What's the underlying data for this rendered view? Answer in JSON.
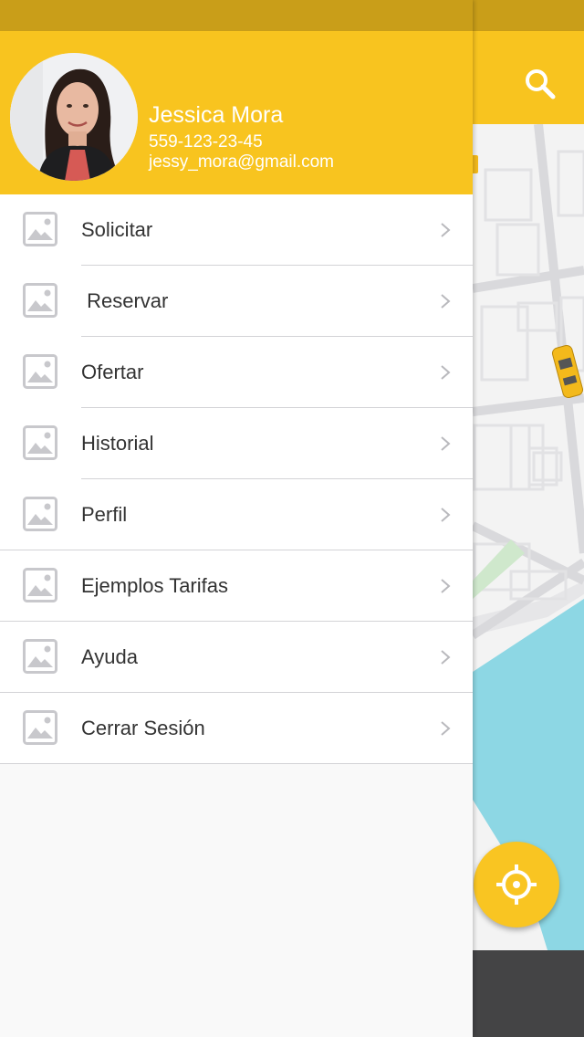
{
  "profile": {
    "name": "Jessica Mora",
    "phone": "559-123-23-45",
    "email": "jessy_mora@gmail.com"
  },
  "menu": {
    "items": [
      {
        "label": "Solicitar",
        "icon": "image-placeholder-icon"
      },
      {
        "label": " Reservar",
        "icon": "image-placeholder-icon"
      },
      {
        "label": "Ofertar",
        "icon": "image-placeholder-icon"
      },
      {
        "label": "Historial",
        "icon": "image-placeholder-icon"
      },
      {
        "label": "Perfil",
        "icon": "image-placeholder-icon"
      },
      {
        "label": "Ejemplos Tarifas",
        "icon": "image-placeholder-icon"
      },
      {
        "label": "Ayuda",
        "icon": "image-placeholder-icon"
      },
      {
        "label": "Cerrar Sesión",
        "icon": "image-placeholder-icon"
      }
    ]
  },
  "colors": {
    "brand_yellow": "#f8c41f",
    "status_bar": "#c99e19",
    "water": "#8dd7e4",
    "bottom_bar": "#444445"
  },
  "icons": {
    "search": "search-icon",
    "locate": "crosshair-icon",
    "chevron": "chevron-right-icon",
    "taxi": "taxi-icon"
  }
}
